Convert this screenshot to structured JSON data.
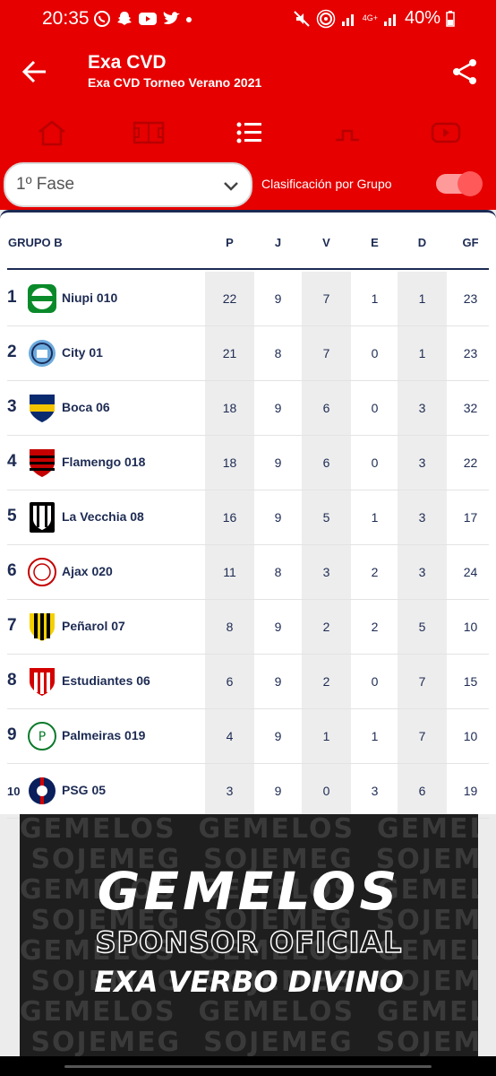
{
  "status_bar": {
    "time": "20:35",
    "network_label": "4G+",
    "battery": "40%"
  },
  "app_bar": {
    "title": "Exa CVD",
    "subtitle": "Exa CVD Torneo Verano 2021"
  },
  "tabs": [
    {
      "icon": "home-icon"
    },
    {
      "icon": "field-icon"
    },
    {
      "icon": "list-icon",
      "active": true
    },
    {
      "icon": "bracket-icon"
    },
    {
      "icon": "video-icon"
    }
  ],
  "filters": {
    "phase_selected": "1º Fase",
    "group_toggle_label": "Clasificación por Grupo"
  },
  "table": {
    "group_title": "GRUPO B",
    "columns": [
      "P",
      "J",
      "V",
      "E",
      "D",
      "GF"
    ],
    "rows": [
      {
        "pos": "1",
        "team": "Niupi 010",
        "P": "22",
        "J": "9",
        "V": "7",
        "E": "1",
        "D": "1",
        "GF": "23"
      },
      {
        "pos": "2",
        "team": "City 01",
        "P": "21",
        "J": "8",
        "V": "7",
        "E": "0",
        "D": "1",
        "GF": "23"
      },
      {
        "pos": "3",
        "team": "Boca 06",
        "P": "18",
        "J": "9",
        "V": "6",
        "E": "0",
        "D": "3",
        "GF": "32"
      },
      {
        "pos": "4",
        "team": "Flamengo 018",
        "P": "18",
        "J": "9",
        "V": "6",
        "E": "0",
        "D": "3",
        "GF": "22"
      },
      {
        "pos": "5",
        "team": "La Vecchia 08",
        "P": "16",
        "J": "9",
        "V": "5",
        "E": "1",
        "D": "3",
        "GF": "17"
      },
      {
        "pos": "6",
        "team": "Ajax 020",
        "P": "11",
        "J": "8",
        "V": "3",
        "E": "2",
        "D": "3",
        "GF": "24"
      },
      {
        "pos": "7",
        "team": "Peñarol 07",
        "P": "8",
        "J": "9",
        "V": "2",
        "E": "2",
        "D": "5",
        "GF": "10"
      },
      {
        "pos": "8",
        "team": "Estudiantes 06",
        "P": "6",
        "J": "9",
        "V": "2",
        "E": "0",
        "D": "7",
        "GF": "15"
      },
      {
        "pos": "9",
        "team": "Palmeiras 019",
        "P": "4",
        "J": "9",
        "V": "1",
        "E": "1",
        "D": "7",
        "GF": "10"
      },
      {
        "pos": "10",
        "team": "PSG 05",
        "P": "3",
        "J": "9",
        "V": "0",
        "E": "3",
        "D": "6",
        "GF": "19"
      }
    ]
  },
  "banner": {
    "brand": "GEMELOS",
    "line2": "SPONSOR OFICIAL",
    "line3": "EXA VERBO DIVINO"
  },
  "colors": {
    "primary": "#e60000",
    "navy": "#1d2b53"
  }
}
